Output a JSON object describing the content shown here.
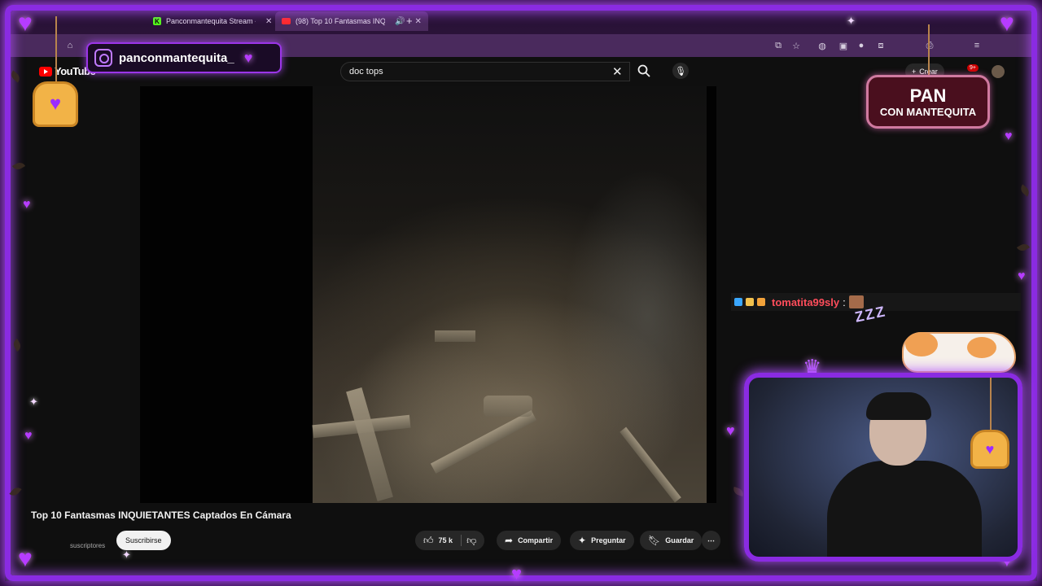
{
  "browser": {
    "tabs": [
      {
        "title": "Panconmantequita Stream - W",
        "favicon": "kick-icon",
        "active": false
      },
      {
        "title": "(98) Top 10 Fantasmas INQ",
        "favicon": "youtube-icon",
        "active": true
      }
    ],
    "new_tab_glyph": "+",
    "close_glyph": "✕"
  },
  "youtube": {
    "logo_text": "YouTube",
    "search": {
      "value": "doc tops"
    },
    "create_label": "Crear",
    "notifications_count": "9+",
    "video_title": "Top 10 Fantasmas INQUIETANTES Captados En Cámara",
    "subscribers_text": "suscriptores",
    "subscribe_label": "Suscribirse",
    "likes": "75 k",
    "share_label": "Compartir",
    "ask_label": "Preguntar",
    "save_label": "Guardar",
    "more_glyph": "⋯"
  },
  "overlay": {
    "instagram_handle": "panconmantequita_",
    "sign_line1": "PAN",
    "sign_line2": "CON MANTEQUITA",
    "chat": {
      "user": "tomatita99sly",
      "separator": ":"
    },
    "zzz": "ZZZ",
    "accent_color": "#8a2be2"
  }
}
